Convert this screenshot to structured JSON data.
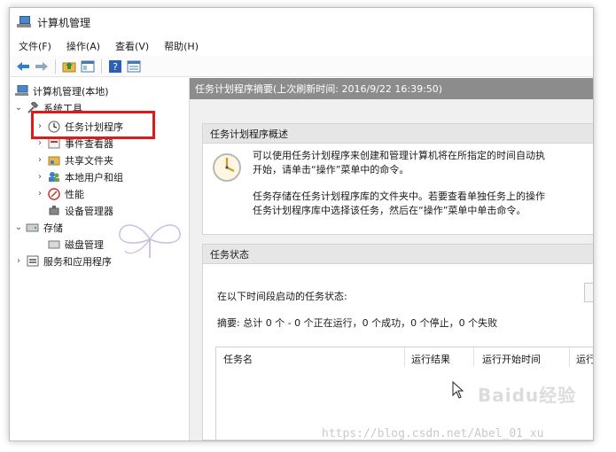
{
  "window": {
    "title": "计算机管理"
  },
  "menu": {
    "file": "文件(F)",
    "action": "操作(A)",
    "view": "查看(V)",
    "help": "帮助(H)"
  },
  "toolbar": {
    "icons": [
      "back-arrow-icon",
      "forward-arrow-icon",
      "folder-up-icon",
      "show-hide-tree-icon",
      "help-icon",
      "properties-icon"
    ]
  },
  "tree": {
    "root": "计算机管理(本地)",
    "system_tools": "系统工具",
    "task_scheduler": "任务计划程序",
    "event_viewer": "事件查看器",
    "shared_folders": "共享文件夹",
    "local_users": "本地用户和组",
    "performance": "性能",
    "device_manager": "设备管理器",
    "storage": "存储",
    "disk_management": "磁盘管理",
    "services_apps": "服务和应用程序"
  },
  "main": {
    "header": "任务计划程序摘要(上次刷新时间: 2016/9/22 16:39:50)",
    "overview": {
      "title": "任务计划程序概述",
      "line1": "可以使用任务计划程序来创建和管理计算机将在所指定的时间自动执",
      "line2": "开始，请单击“操作”菜单中的命令。",
      "line3": "任务存储在任务计划程序库的文件夹中。若要查看单独任务上的操作",
      "line4": "任务计划程序库中选择该任务，然后在“操作”菜单中单击命令。"
    },
    "status": {
      "title": "任务状态",
      "prompt": "在以下时间段启动的任务状态:",
      "summary": "摘要: 总计 0 个 - 0 个正在运行，0 个成功，0 个停止，0 个失败"
    },
    "table": {
      "columns": [
        "任务名",
        "运行结果",
        "运行开始时间",
        "运行"
      ]
    }
  },
  "watermarks": {
    "baidu": "Baidu经验",
    "url": "https://blog.csdn.net/Abel_01_xu"
  },
  "colors": {
    "highlight_border": "#e01a1a",
    "header_bg": "#8c8c8c",
    "section_head_bg": "#e6e6e6"
  }
}
